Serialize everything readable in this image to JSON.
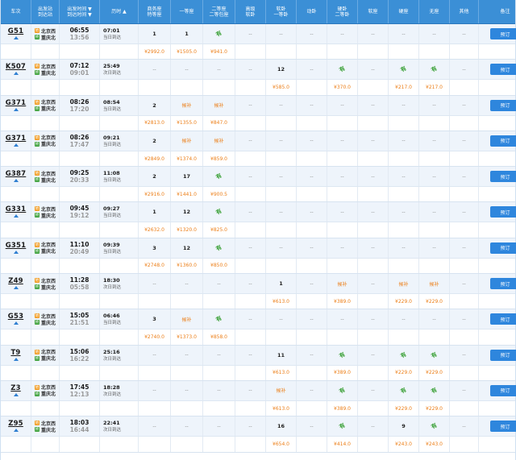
{
  "header": {
    "train": "车次",
    "stations": "出发站\n到达站",
    "times": "出发时间 ▼\n到达时间 ▼",
    "duration": "历时 ▲",
    "business": "商务座\n特等座",
    "first": "一等座",
    "second": "二等座\n二等包座",
    "advanced_soft_sleeper": "高级\n软卧",
    "soft_sleeper": "软卧\n一等卧",
    "bullet_sleeper": "动卧",
    "hard_sleeper": "硬卧\n二等卧",
    "soft_seat": "软座",
    "hard_seat": "硬座",
    "no_seat": "无座",
    "other": "其他",
    "note": "备注"
  },
  "labels": {
    "from_station": "北京西",
    "to_station": "重庆北",
    "from_badge": "始",
    "to_badge": "终",
    "book_button": "预订",
    "have_tickets": "有"
  },
  "colors": {
    "header_bg": "#3b8fd6",
    "price": "#ec7e17",
    "available": "#3ea23a",
    "button": "#2e86dd"
  },
  "trains": [
    {
      "no": "G51",
      "dep": "06:55",
      "arr": "13:56",
      "dur": "07:01",
      "arrival_day": "当日到达",
      "seats": [
        "1",
        "1",
        "有",
        "--",
        "--",
        "--",
        "--",
        "--",
        "--",
        "--",
        "--"
      ],
      "prices": [
        "¥2992.0",
        "¥1505.0",
        "¥941.0",
        "",
        "",
        "",
        "",
        "",
        "",
        "",
        ""
      ]
    },
    {
      "no": "K507",
      "dep": "07:12",
      "arr": "09:01",
      "dur": "25:49",
      "arrival_day": "次日到达",
      "seats": [
        "--",
        "--",
        "--",
        "--",
        "12",
        "--",
        "有",
        "--",
        "有",
        "有",
        "--"
      ],
      "prices": [
        "",
        "",
        "",
        "",
        "¥585.0",
        "",
        "¥370.0",
        "",
        "¥217.0",
        "¥217.0",
        ""
      ]
    },
    {
      "no": "G371",
      "dep": "08:26",
      "arr": "17:20",
      "dur": "08:54",
      "arrival_day": "当日到达",
      "seats": [
        "2",
        "候补",
        "候补",
        "--",
        "--",
        "--",
        "--",
        "--",
        "--",
        "--",
        "--"
      ],
      "prices": [
        "¥2813.0",
        "¥1355.0",
        "¥847.0",
        "",
        "",
        "",
        "",
        "",
        "",
        "",
        ""
      ]
    },
    {
      "no": "G371",
      "dep": "08:26",
      "arr": "17:47",
      "dur": "09:21",
      "arrival_day": "当日到达",
      "seats": [
        "2",
        "候补",
        "候补",
        "--",
        "--",
        "--",
        "--",
        "--",
        "--",
        "--",
        "--"
      ],
      "prices": [
        "¥2849.0",
        "¥1374.0",
        "¥859.0",
        "",
        "",
        "",
        "",
        "",
        "",
        "",
        ""
      ]
    },
    {
      "no": "G387",
      "dep": "09:25",
      "arr": "20:33",
      "dur": "11:08",
      "arrival_day": "当日到达",
      "seats": [
        "2",
        "17",
        "有",
        "--",
        "--",
        "--",
        "--",
        "--",
        "--",
        "--",
        "--"
      ],
      "prices": [
        "¥2916.0",
        "¥1441.0",
        "¥900.5",
        "",
        "",
        "",
        "",
        "",
        "",
        "",
        ""
      ]
    },
    {
      "no": "G331",
      "dep": "09:45",
      "arr": "19:12",
      "dur": "09:27",
      "arrival_day": "当日到达",
      "seats": [
        "1",
        "12",
        "有",
        "--",
        "--",
        "--",
        "--",
        "--",
        "--",
        "--",
        "--"
      ],
      "prices": [
        "¥2632.0",
        "¥1320.0",
        "¥825.0",
        "",
        "",
        "",
        "",
        "",
        "",
        "",
        ""
      ]
    },
    {
      "no": "G351",
      "dep": "11:10",
      "arr": "20:49",
      "dur": "09:39",
      "arrival_day": "当日到达",
      "seats": [
        "3",
        "12",
        "有",
        "--",
        "--",
        "--",
        "--",
        "--",
        "--",
        "--",
        "--"
      ],
      "prices": [
        "¥2748.0",
        "¥1360.0",
        "¥850.0",
        "",
        "",
        "",
        "",
        "",
        "",
        "",
        ""
      ]
    },
    {
      "no": "Z49",
      "dep": "11:28",
      "arr": "05:58",
      "dur": "18:30",
      "arrival_day": "次日到达",
      "seats": [
        "--",
        "--",
        "--",
        "--",
        "1",
        "--",
        "候补",
        "--",
        "候补",
        "候补",
        "--"
      ],
      "prices": [
        "",
        "",
        "",
        "",
        "¥613.0",
        "",
        "¥389.0",
        "",
        "¥229.0",
        "¥229.0",
        ""
      ]
    },
    {
      "no": "G53",
      "dep": "15:05",
      "arr": "21:51",
      "dur": "06:46",
      "arrival_day": "当日到达",
      "seats": [
        "3",
        "候补",
        "有",
        "--",
        "--",
        "--",
        "--",
        "--",
        "--",
        "--",
        "--"
      ],
      "prices": [
        "¥2740.0",
        "¥1373.0",
        "¥858.0",
        "",
        "",
        "",
        "",
        "",
        "",
        "",
        ""
      ]
    },
    {
      "no": "T9",
      "dep": "15:06",
      "arr": "16:22",
      "dur": "25:16",
      "arrival_day": "次日到达",
      "seats": [
        "--",
        "--",
        "--",
        "--",
        "11",
        "--",
        "有",
        "--",
        "有",
        "有",
        "--"
      ],
      "prices": [
        "",
        "",
        "",
        "",
        "¥613.0",
        "",
        "¥389.0",
        "",
        "¥229.0",
        "¥229.0",
        ""
      ]
    },
    {
      "no": "Z3",
      "dep": "17:45",
      "arr": "12:13",
      "dur": "18:28",
      "arrival_day": "次日到达",
      "seats": [
        "--",
        "--",
        "--",
        "--",
        "候补",
        "--",
        "有",
        "--",
        "有",
        "有",
        "--"
      ],
      "prices": [
        "",
        "",
        "",
        "",
        "¥613.0",
        "",
        "¥389.0",
        "",
        "¥229.0",
        "¥229.0",
        ""
      ]
    },
    {
      "no": "Z95",
      "dep": "18:03",
      "arr": "16:44",
      "dur": "22:41",
      "arrival_day": "次日到达",
      "seats": [
        "--",
        "--",
        "--",
        "--",
        "16",
        "--",
        "有",
        "--",
        "9",
        "有",
        "--"
      ],
      "prices": [
        "",
        "",
        "",
        "",
        "¥654.0",
        "",
        "¥414.0",
        "",
        "¥243.0",
        "¥243.0",
        ""
      ]
    }
  ]
}
